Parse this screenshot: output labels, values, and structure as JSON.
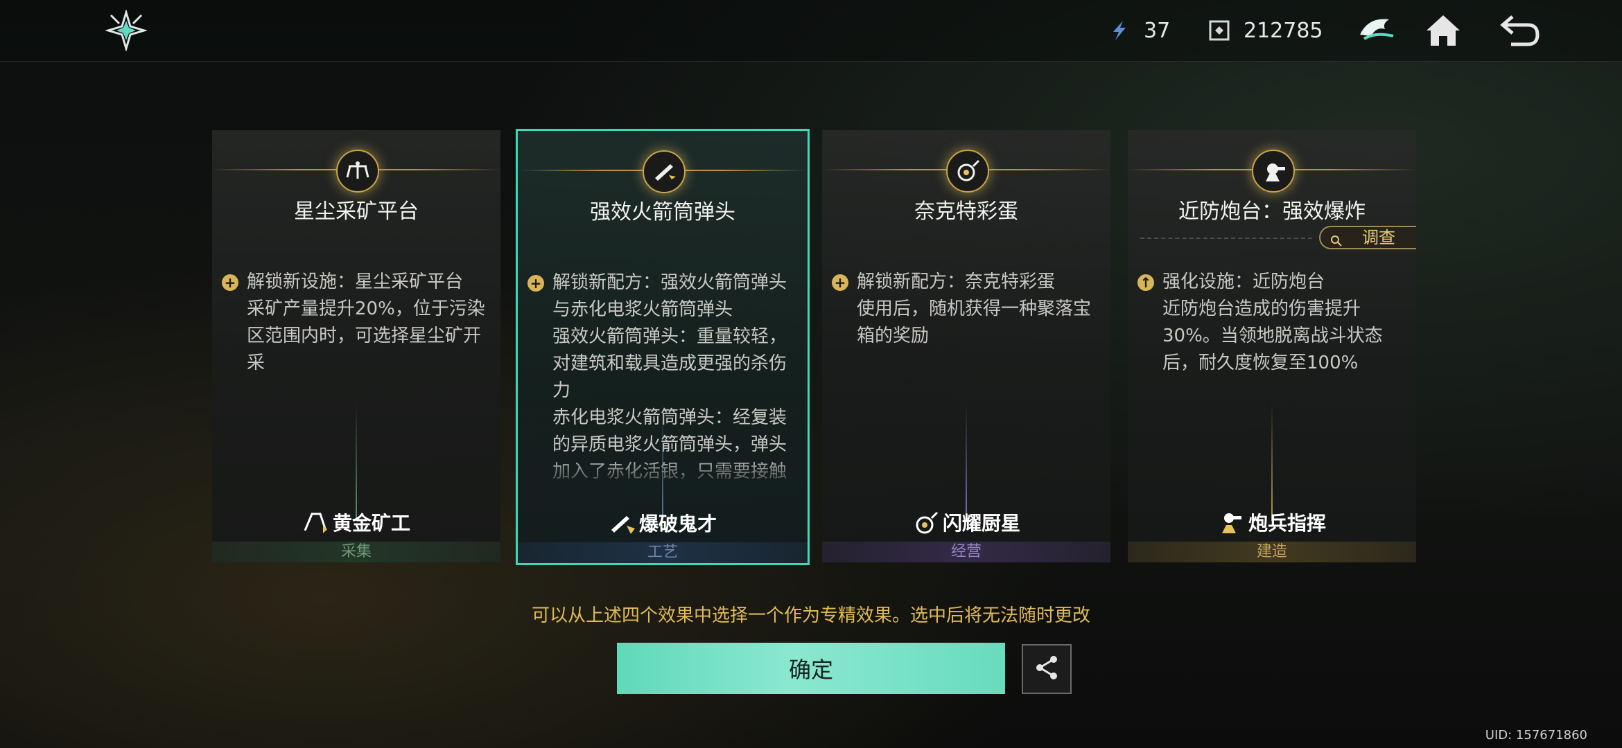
{
  "header": {
    "logo_icon": "winged-star-logo-icon",
    "resource1": {
      "icon": "energy-crystal-icon",
      "value": "37"
    },
    "resource2": {
      "icon": "currency-chip-icon",
      "value": "212785"
    },
    "icons": [
      "faction-emblem-icon",
      "home-icon",
      "back-arrow-icon"
    ]
  },
  "cards": [
    {
      "title": "星尘采矿平台",
      "icon": "mining-rig-icon",
      "bullet": "+",
      "description": "解锁新设施：星尘采矿平台\n采矿产量提升20%，位于污染区范围内时，可选择星尘矿开采",
      "badge": "黄金矿工",
      "badge_icon": "gold-miner-icon",
      "category": "采集",
      "category_color": "#6f9a78"
    },
    {
      "title": "强效火箭筒弹头",
      "icon": "rocket-launcher-icon",
      "bullet": "+",
      "description": "解锁新配方：强效火箭筒弹头与赤化电浆火箭筒弹头\n强效火箭筒弹头：重量较轻，对建筑和载具造成更强的杀伤力\n赤化电浆火箭筒弹头：经复装的异质电浆火箭筒弹头，弹头加入了赤化活银，只需要接触就能引发大规模的爆",
      "badge": "爆破鬼才",
      "badge_icon": "demolition-icon",
      "category": "工艺",
      "category_color": "#6e86aa",
      "selected": true
    },
    {
      "title": "奈克特彩蛋",
      "icon": "frying-pan-icon",
      "bullet": "+",
      "description": "解锁新配方：奈克特彩蛋\n使用后，随机获得一种聚落宝箱的奖励",
      "badge": "闪耀厨星",
      "badge_icon": "chef-icon",
      "category": "经营",
      "category_color": "#9584c0"
    },
    {
      "title": "近防炮台：强效爆炸",
      "icon": "turret-icon",
      "bullet": "↑",
      "description": "强化设施：近防炮台\n近防炮台造成的伤害提升30%。当领地脱离战斗状态后，耐久度恢复至100%",
      "badge": "炮兵指挥",
      "badge_icon": "artillery-icon",
      "category": "建造",
      "category_color": "#c2a15a",
      "inspect_label": "调查"
    }
  ],
  "hint": "可以从上述四个效果中选择一个作为专精效果。选中后将无法随时更改",
  "confirm_label": "确定",
  "share_icon": "share-icon",
  "uid": "UID: 157671860",
  "colors": {
    "accent": "#3fd9b5",
    "gold": "#e0bb55"
  }
}
